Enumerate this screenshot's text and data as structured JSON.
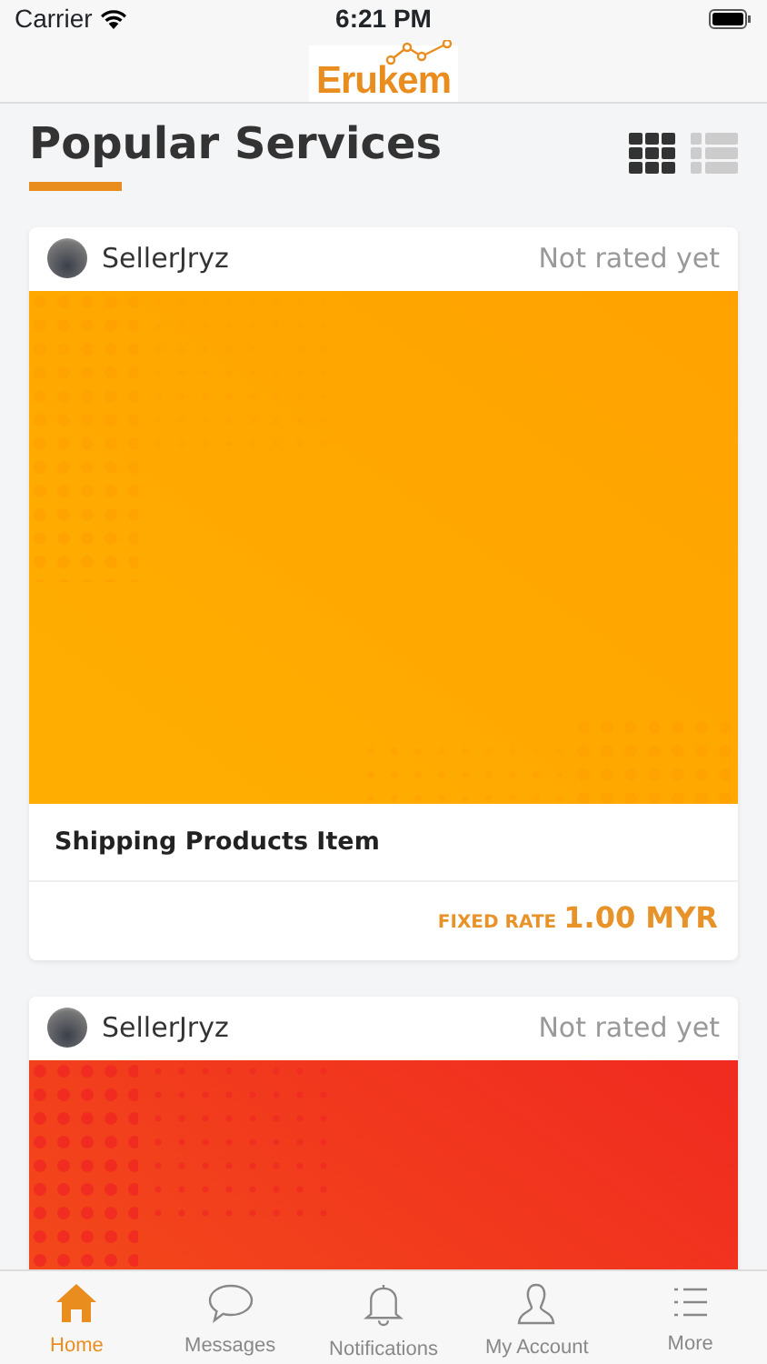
{
  "status_bar": {
    "carrier": "Carrier",
    "time": "6:21 PM"
  },
  "header": {
    "logo": "Erukem"
  },
  "section": {
    "title": "Popular Services"
  },
  "view_toggles": [
    {
      "kind": "grid",
      "selected": true
    },
    {
      "kind": "list",
      "selected": false
    }
  ],
  "services": [
    {
      "seller": "SellerJryz",
      "rating": "Not rated yet",
      "color": "#ffa200",
      "title": "Shipping Products Item",
      "rate_label": "FIXED RATE",
      "price": "1.00 MYR"
    },
    {
      "seller": "SellerJryz",
      "rating": "Not rated yet",
      "color": "#f02a20"
    }
  ],
  "tab_bar": [
    {
      "kind": "home",
      "label": "Home",
      "selected": true
    },
    {
      "kind": "messages",
      "label": "Messages",
      "selected": false
    },
    {
      "kind": "notifications",
      "label": "Notifications",
      "selected": false
    },
    {
      "kind": "account",
      "label": "My Account",
      "selected": false
    },
    {
      "kind": "more",
      "label": "More",
      "selected": false
    }
  ]
}
